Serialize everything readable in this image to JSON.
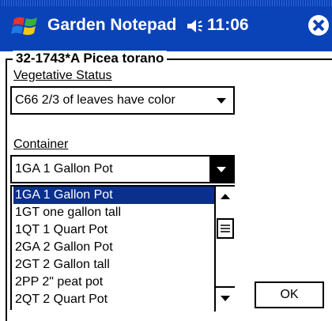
{
  "titlebar": {
    "app_title": "Garden Notepad",
    "time": "11:06",
    "icons": [
      "windows-flag-icon",
      "speaker-icon",
      "close-icon"
    ],
    "background_color": "#0a42b8"
  },
  "form": {
    "group_title": "32-1743*A Picea torano",
    "vegetative_status": {
      "label": "Vegetative Status",
      "value": "C66 2/3 of leaves have color"
    },
    "container": {
      "label": "Container",
      "value": "1GA 1 Gallon Pot",
      "options": [
        {
          "label": "1GA 1 Gallon Pot",
          "selected": true
        },
        {
          "label": "1GT one gallon tall"
        },
        {
          "label": "1QT 1 Quart Pot"
        },
        {
          "label": "2GA 2 Gallon Pot"
        },
        {
          "label": "2GT 2 Gallon tall"
        },
        {
          "label": "2PP 2\" peat pot"
        },
        {
          "label": "2QT 2 Quart Pot"
        }
      ]
    },
    "ok_label": "OK",
    "selection_color": "#0a2f8c"
  }
}
